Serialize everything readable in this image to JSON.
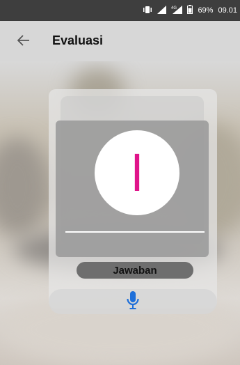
{
  "status_bar": {
    "battery": "69%",
    "time": "09.01",
    "network": "4G",
    "icons": [
      "vibrate-icon",
      "signal-icon",
      "lte-signal-icon",
      "battery-icon"
    ]
  },
  "app_bar": {
    "back_icon": "arrow-left-icon",
    "title": "Evaluasi"
  },
  "quiz": {
    "letter": "ا",
    "answer_label": "Jawaban",
    "mic_icon": "microphone-icon"
  },
  "colors": {
    "accent_letter": "#e0148a",
    "mic": "#1e6fd9",
    "app_bar": "#d7d7d7",
    "status_bar": "#3e3e3e"
  }
}
